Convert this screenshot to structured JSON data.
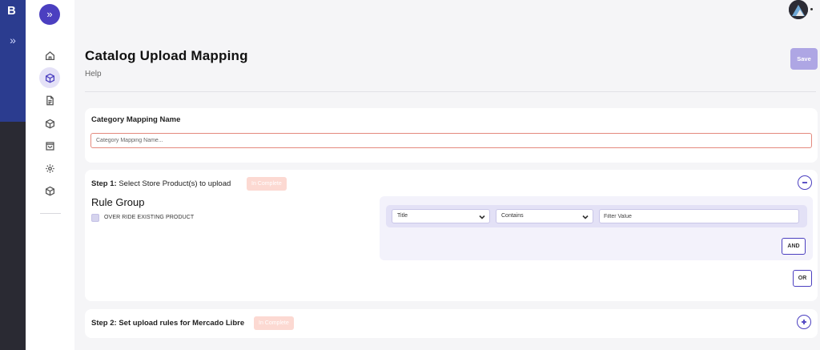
{
  "app": {
    "logo_text": "B",
    "expand_glyph": "»"
  },
  "sidebar": {
    "expand_glyph": "»",
    "items": [
      {
        "icon": "home-icon",
        "active": false
      },
      {
        "icon": "cube-icon",
        "active": true
      },
      {
        "icon": "document-icon",
        "active": false
      },
      {
        "icon": "box-icon",
        "active": false
      },
      {
        "icon": "shopping-bag-icon",
        "active": false
      },
      {
        "icon": "gear-icon",
        "active": false
      },
      {
        "icon": "package-icon",
        "active": false
      }
    ]
  },
  "header": {
    "title": "Catalog Upload Mapping",
    "help": "Help",
    "save_label": "Save"
  },
  "category_mapping": {
    "label": "Category Mapping Name",
    "placeholder": "Category Mapping Name...",
    "value": ""
  },
  "step1": {
    "prefix": "Step 1:",
    "title": "Select Store Product(s) to upload",
    "status": "In Complete",
    "rule_group_title": "Rule Group",
    "override_label": "OVER RIDE EXISTING PRODUCT",
    "override_checked": false,
    "rule": {
      "field": "Title",
      "operator": "Contains",
      "filter_placeholder": "Filter Value",
      "filter_value": ""
    },
    "and_label": "AND",
    "or_label": "OR"
  },
  "step2": {
    "prefix": "Step 2:",
    "title": "Set upload rules for Mercado Libre",
    "status": "In Complete"
  },
  "colors": {
    "accent": "#4b3fc0",
    "save_bg": "#aea6e4",
    "status_badge_bg": "#fcd9d2",
    "input_error_border": "#e48a7e",
    "strip_top": "#2b3c8f",
    "strip_bottom": "#2a2a33"
  }
}
